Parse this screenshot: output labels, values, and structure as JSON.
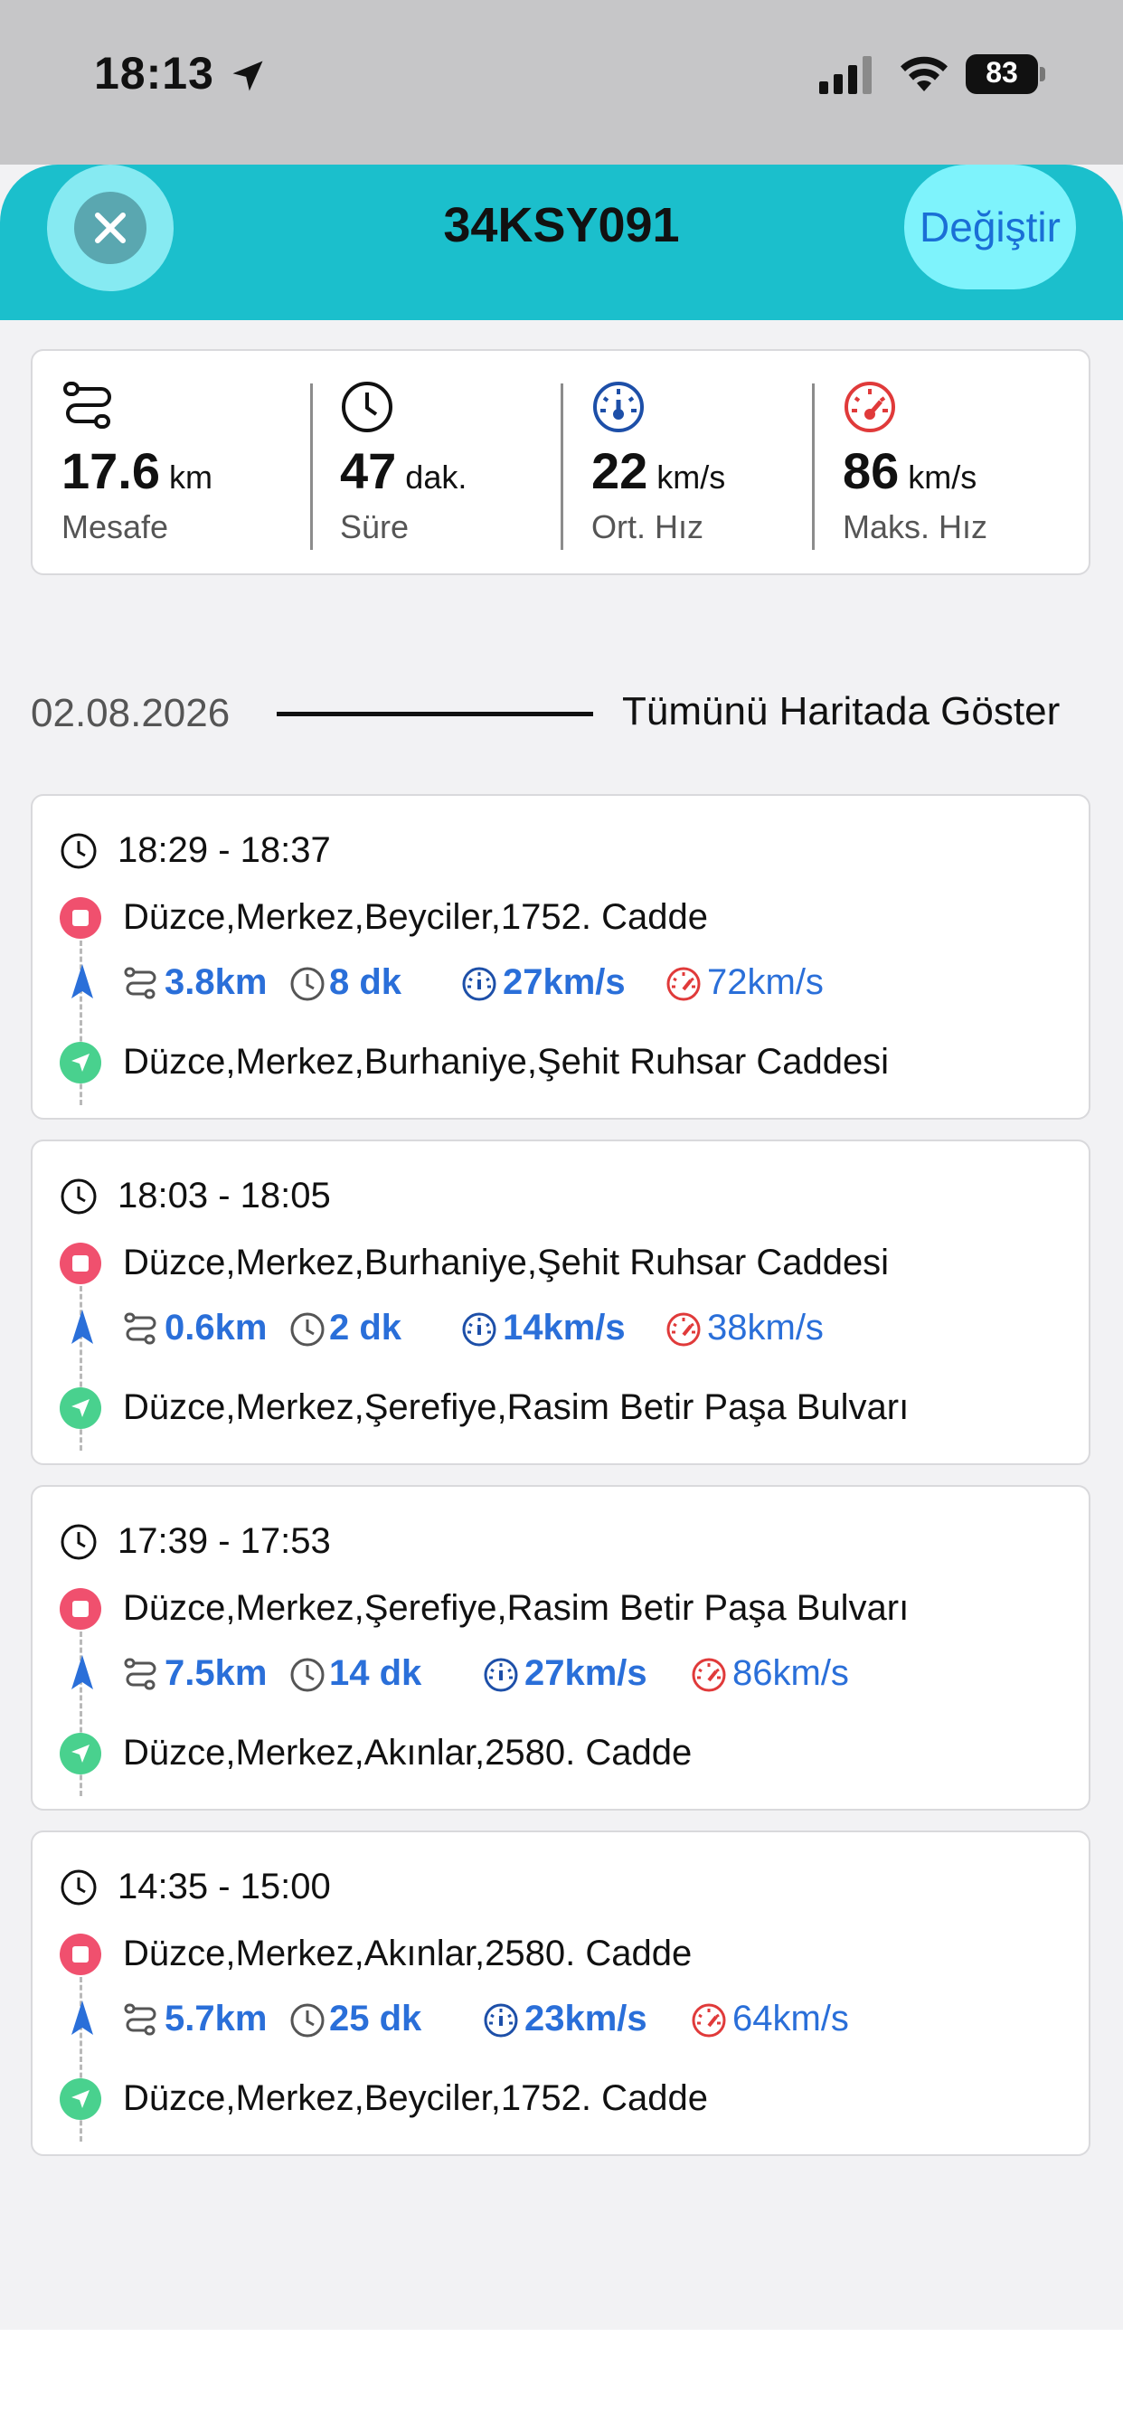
{
  "status_bar": {
    "time": "18:13",
    "battery": "83"
  },
  "header": {
    "title": "34KSY091",
    "change_label": "Değiştir"
  },
  "stats": [
    {
      "value": "17.6",
      "unit": "km",
      "label": "Mesafe",
      "icon": "route-icon"
    },
    {
      "value": "47",
      "unit": "dak.",
      "label": "Süre",
      "icon": "clock-icon"
    },
    {
      "value": "22",
      "unit": "km/s",
      "label": "Ort. Hız",
      "icon": "speedometer-avg-icon"
    },
    {
      "value": "86",
      "unit": "km/s",
      "label": "Maks. Hız",
      "icon": "speedometer-max-icon"
    }
  ],
  "date_row": {
    "date": "02.08.2026",
    "show_all": "Tümünü Haritada Göster"
  },
  "trips": [
    {
      "time": "18:29 - 18:37",
      "start": "Düzce,Merkez,Beyciler,1752. Cadde",
      "distance": "3.8km",
      "duration": "8 dk",
      "avg_speed": "27km/s",
      "max_speed": "72km/s",
      "end": "Düzce,Merkez,Burhaniye,Şehit Ruhsar Caddesi"
    },
    {
      "time": "18:03 - 18:05",
      "start": "Düzce,Merkez,Burhaniye,Şehit Ruhsar Caddesi",
      "distance": "0.6km",
      "duration": "2 dk",
      "avg_speed": "14km/s",
      "max_speed": "38km/s",
      "end": "Düzce,Merkez,Şerefiye,Rasim Betir Paşa Bulvarı"
    },
    {
      "time": "17:39 - 17:53",
      "start": "Düzce,Merkez,Şerefiye,Rasim Betir Paşa Bulvarı",
      "distance": "7.5km",
      "duration": "14 dk",
      "avg_speed": "27km/s",
      "max_speed": "86km/s",
      "end": "Düzce,Merkez,Akınlar,2580. Cadde"
    },
    {
      "time": "14:35 - 15:00",
      "start": "Düzce,Merkez,Akınlar,2580. Cadde",
      "distance": "5.7km",
      "duration": "25 dk",
      "avg_speed": "23km/s",
      "max_speed": "64km/s",
      "end": "Düzce,Merkez,Beyciler,1752. Cadde"
    }
  ],
  "colors": {
    "header": "#1bbfcc",
    "accent_blue": "#2a6fd9",
    "max_red": "#e03a3a",
    "start": "#f0506e",
    "end": "#49d18e"
  }
}
